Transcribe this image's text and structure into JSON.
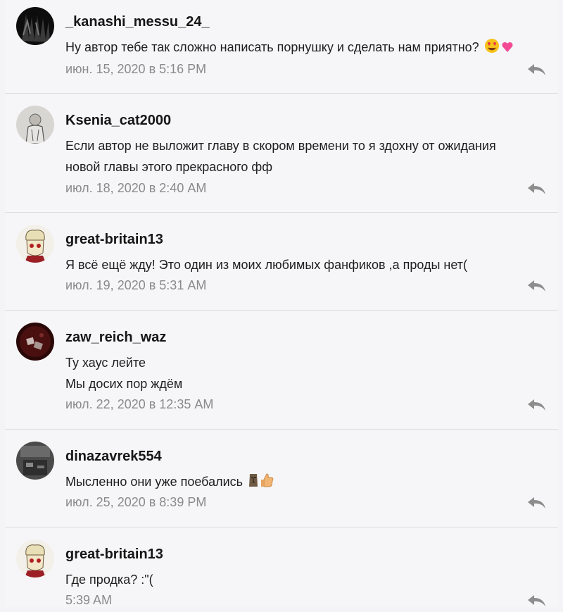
{
  "comments": [
    {
      "author": "_kanashi_messu_24_",
      "lines": [
        "Ну автор тебе так сложно написать порнушку и сделать нам приятно?"
      ],
      "emoji": [
        "heart-eyes",
        "pink-heart"
      ],
      "date": "июн. 15, 2020 в 5:16 PM",
      "avatar": "dark-figures-avatar"
    },
    {
      "author": "Ksenia_cat2000",
      "lines": [
        "Если автор не выложит главу в скором времени то я здохну от ожидания",
        "новой главы этого прекрасного фф"
      ],
      "emoji": [],
      "date": "июл. 18, 2020 в 2:40 AM",
      "avatar": "sketch-figure-avatar"
    },
    {
      "author": "great-britain13",
      "lines": [
        "Я всё ещё жду! Это один из моих любимых фанфиков ,а проды нет("
      ],
      "emoji": [],
      "date": "июл. 19, 2020 в 5:31 AM",
      "avatar": "cartoon-character-avatar"
    },
    {
      "author": "zaw_reich_waz",
      "lines": [
        "Ту хаус лейте",
        "Мы досих пор ждём"
      ],
      "emoji": [],
      "date": "июл. 22, 2020 в 12:35 AM",
      "avatar": "dark-red-avatar"
    },
    {
      "author": "dinazavrek554",
      "lines": [
        "Мысленно они уже поебались"
      ],
      "emoji": [
        "moai",
        "thumbs-up"
      ],
      "date": "июл. 25, 2020 в 8:39 PM",
      "avatar": "grey-room-avatar"
    },
    {
      "author": "great-britain13",
      "lines": [
        "Где продка? :\"("
      ],
      "emoji": [],
      "date": "5:39 AM",
      "avatar": "cartoon-character-avatar"
    }
  ],
  "icons": {
    "reply": "reply-arrow-icon"
  },
  "colors": {
    "author": "#161616",
    "text": "#1e1e1e",
    "meta": "#8a8a8a",
    "divider": "#dcdcdf"
  }
}
